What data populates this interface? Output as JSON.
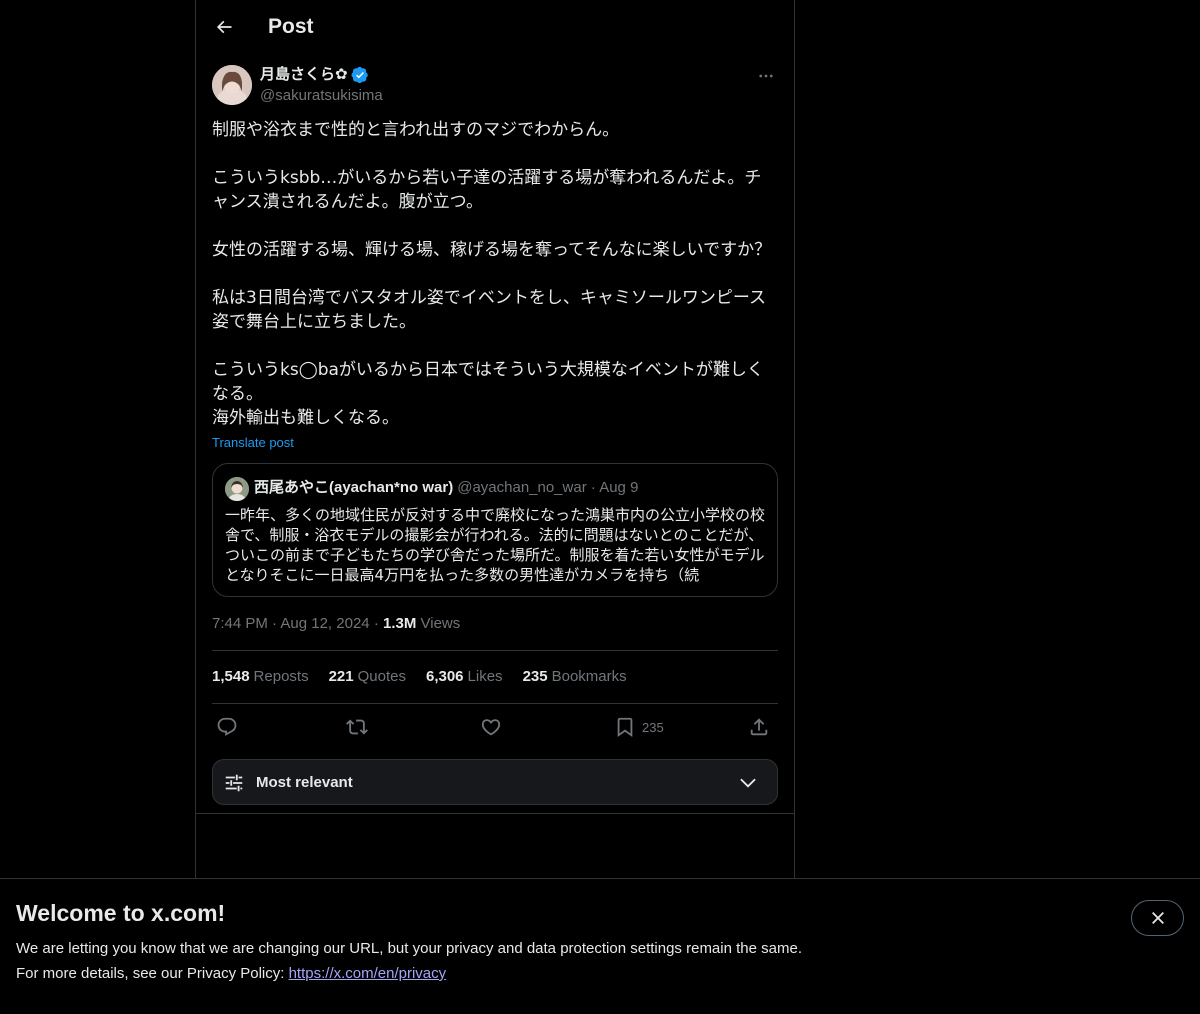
{
  "header": {
    "title": "Post"
  },
  "post": {
    "author_name": "月島さくら✿",
    "author_handle": "@sakuratsukisima",
    "lines": [
      "制服や浴衣まで性的と言われ出すのマジでわからん。",
      "",
      "こういうksbb…がいるから若い子達の活躍する場が奪われるんだよ。チャンス潰されるんだよ。腹が立つ。",
      "",
      "女性の活躍する場、輝ける場、稼げる場を奪ってそんなに楽しいですか？",
      "",
      "私は3日間台湾でバスタオル姿でイベントをし、キャミソールワンピース姿で舞台上に立ちました。",
      "",
      "こういうks◯baがいるから日本ではそういう大規模なイベントが難しくなる。",
      "海外輸出も難しくなる。"
    ],
    "translate_label": "Translate post",
    "time": "7:44 PM",
    "date": "Aug 12, 2024",
    "views_count": "1.3M",
    "views_label": "Views",
    "sep": "·"
  },
  "quote": {
    "name": "西尾あやこ(ayachan*no war)",
    "handle": "@ayachan_no_war",
    "date": "· Aug 9",
    "text": "一昨年、多くの地域住民が反対する中で廃校になった鴻巣市内の公立小学校の校舎で、制服・浴衣モデルの撮影会が行われる。法的に問題はないとのことだが、ついこの前まで子どもたちの学び舎だった場所だ。制服を着た若い女性がモデルとなりそこに一日最高4万円を払った多数の男性達がカメラを持ち（続"
  },
  "stats": [
    {
      "count": "1,548",
      "label": "Reposts"
    },
    {
      "count": "221",
      "label": "Quotes"
    },
    {
      "count": "6,306",
      "label": "Likes"
    },
    {
      "count": "235",
      "label": "Bookmarks"
    }
  ],
  "actions": {
    "bookmark_count": "235"
  },
  "sort": {
    "label": "Most relevant"
  },
  "banner": {
    "title": "Welcome to x.com!",
    "line1": "We are letting you know that we are changing our URL, but your privacy and data protection settings remain the same.",
    "line2_prefix": "For more details, see our Privacy Policy: ",
    "link": "https://x.com/en/privacy"
  },
  "colors": {
    "accent": "#1d9bf0",
    "muted": "#71767b",
    "border": "#2f3336",
    "background": "#000000"
  }
}
